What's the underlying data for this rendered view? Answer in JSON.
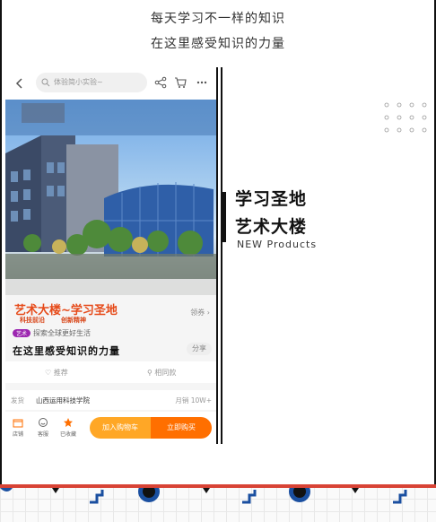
{
  "header": {
    "line1": "每天学习不一样的知识",
    "line2": "在这里感受知识的力量"
  },
  "phone": {
    "search_placeholder": "体验简小实验~",
    "product": {
      "title": "艺术大楼~学习圣地",
      "badge_left": "科技前沿",
      "badge_right": "创新精神",
      "coupon": "领券 ›",
      "spirit_pill": "艺术",
      "spirit_text": "探索全球更好生活",
      "slogan": "在这里感受知识的力量",
      "share": "分享",
      "action_recommend": "推荐",
      "action_similar": "相同款"
    },
    "shipping": {
      "label": "发货",
      "address": "山西运用科技学院",
      "sales": "月销 10W+"
    },
    "tabbar": {
      "shop": "店铺",
      "service": "客服",
      "favorite": "已收藏",
      "add_to_cart": "加入购物车",
      "buy_now": "立即购买"
    }
  },
  "feature": {
    "title_line1": "学习圣地",
    "title_line2": "艺术大楼",
    "subtitle": "NEW Products"
  },
  "colors": {
    "accent_orange": "#ff6f00",
    "accent_red": "#d84335",
    "cart_orange": "#ffa726"
  }
}
